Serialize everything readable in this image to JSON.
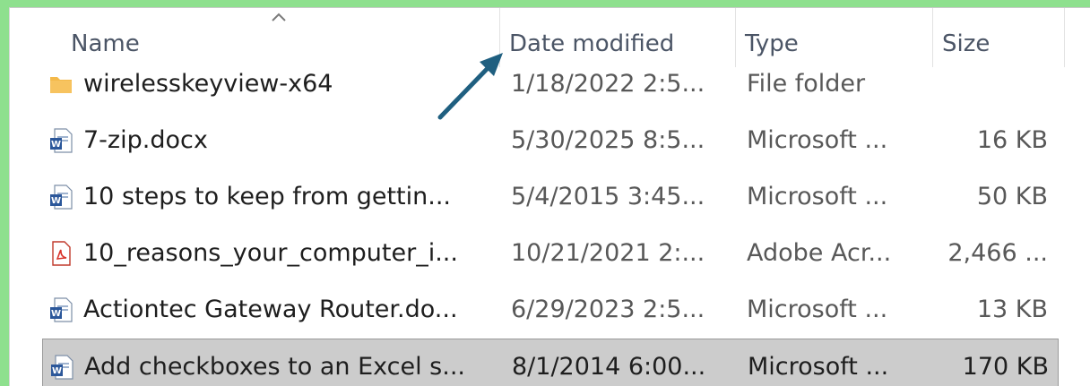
{
  "columns": {
    "name": "Name",
    "date": "Date modified",
    "type": "Type",
    "size": "Size"
  },
  "sort": {
    "column": "name",
    "direction": "ascending",
    "indicator_icon": "chevron-up-icon"
  },
  "rows": [
    {
      "icon": "folder-icon",
      "name": "wirelesskeyview-x64",
      "date": "1/18/2022 2:5...",
      "type": "File folder",
      "size": ""
    },
    {
      "icon": "word-doc-icon",
      "name": "7-zip.docx",
      "date": "5/30/2025 8:5...",
      "type": "Microsoft ...",
      "size": "16 KB"
    },
    {
      "icon": "word-doc-icon",
      "name": "10 steps to keep from gettin...",
      "date": "5/4/2015 3:45...",
      "type": "Microsoft ...",
      "size": "50 KB"
    },
    {
      "icon": "pdf-icon",
      "name": "10_reasons_your_computer_i...",
      "date": "10/21/2021 2:...",
      "type": "Adobe Acr...",
      "size": "2,466 ..."
    },
    {
      "icon": "word-doc-icon",
      "name": "Actiontec Gateway Router.do...",
      "date": "6/29/2023 2:5...",
      "type": "Microsoft ...",
      "size": "13 KB"
    },
    {
      "icon": "word-doc-icon",
      "name": "Add checkboxes to an Excel s...",
      "date": "8/1/2014 6:00...",
      "type": "Microsoft ...",
      "size": "170 KB",
      "selected": true
    }
  ],
  "annotation": {
    "type": "arrow",
    "color": "#1f5f80",
    "points_to": "date-modified-column-header"
  },
  "colors": {
    "frame": "#8ee08e",
    "selection": "#cccccc",
    "folder": "#f4b94a",
    "word": "#2b579a",
    "pdf": "#d9342b"
  }
}
